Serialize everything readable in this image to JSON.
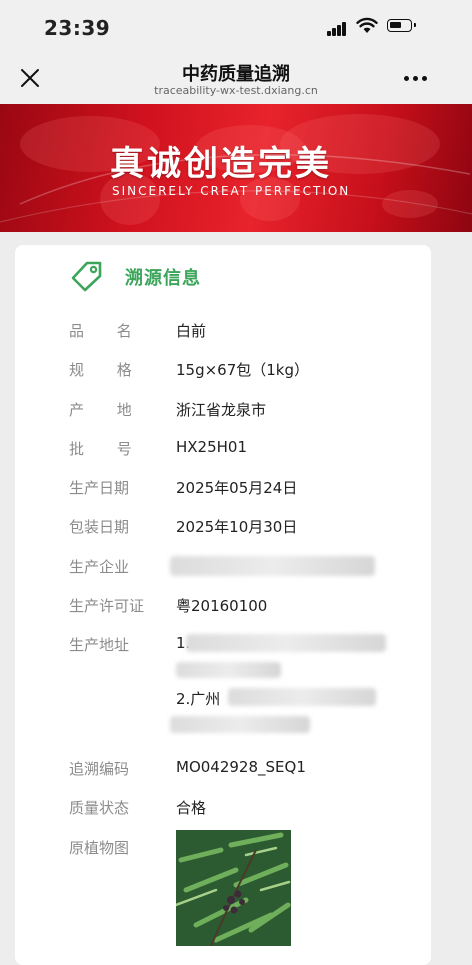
{
  "status_bar": {
    "time": "23:39"
  },
  "nav": {
    "title": "中药质量追溯",
    "url": "traceability-wx-test.dxiang.cn"
  },
  "banner": {
    "heading": "真诚创造完美",
    "subheading": "SINCERELY CREAT PERFECTION"
  },
  "section": {
    "title": "溯源信息"
  },
  "info": {
    "product_name_label": "品 名",
    "product_name": "白前",
    "spec_label": "规 格",
    "spec": "15g×67包（1kg）",
    "origin_label": "产 地",
    "origin": "浙江省龙泉市",
    "batch_label": "批 号",
    "batch": "HX25H01",
    "production_date_label": "生产日期",
    "production_date": "2025年05月24日",
    "packaging_date_label": "包装日期",
    "packaging_date": "2025年10月30日",
    "manufacturer_label": "生产企业",
    "license_label": "生产许可证",
    "license": "粤20160100",
    "address_label": "生产地址",
    "address_line1_prefix": "1.",
    "address_line2_prefix": "2.广州",
    "trace_code_label": "追溯编码",
    "trace_code": "MO042928_SEQ1",
    "quality_status_label": "质量状态",
    "quality_status": "合格",
    "plant_image_label": "原植物图"
  },
  "colors": {
    "accent_green": "#3ba55a",
    "banner_red": "#d0121e",
    "label_gray": "#8c8c8c"
  }
}
